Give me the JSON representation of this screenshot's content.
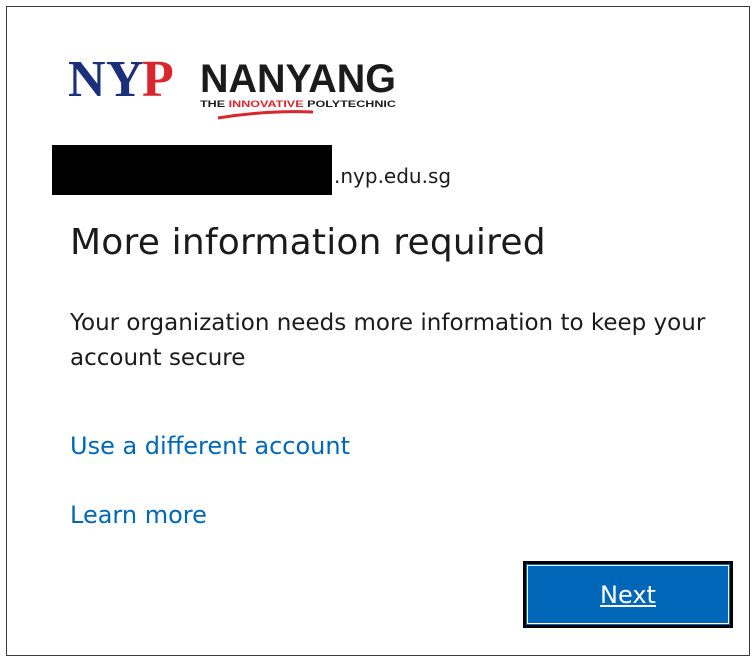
{
  "brand": {
    "name": "NANYANG",
    "monogram": "NYP",
    "tagline_prefix": "THE ",
    "tagline_highlight": "INNOVATIVE",
    "tagline_suffix": " POLYTECHNIC",
    "colors": {
      "navy": "#1c2f7d",
      "red": "#d7262d"
    }
  },
  "account": {
    "domain_suffix": ".nyp.edu.sg"
  },
  "main": {
    "title": "More information required",
    "description": "Your organization needs more information to keep your account secure"
  },
  "links": {
    "different_account": "Use a different account",
    "learn_more": "Learn more"
  },
  "actions": {
    "next_label": "Next"
  },
  "colors": {
    "link": "#0067b8",
    "button": "#0067b8",
    "text": "#1b1b1b"
  }
}
